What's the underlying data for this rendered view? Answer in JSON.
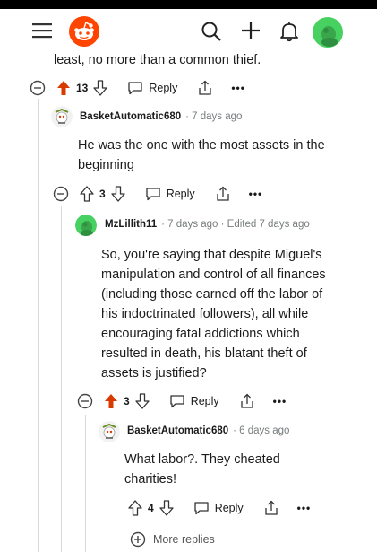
{
  "header": {
    "menu_icon": "hamburger-icon",
    "logo_icon": "reddit-logo-icon",
    "search_icon": "search-icon",
    "create_icon": "plus-icon",
    "notifications_icon": "bell-icon",
    "avatar_icon": "user-avatar-icon"
  },
  "top_comment": {
    "text_tail": "least, no more than a common thief.",
    "votes": "13",
    "reply_label": "Reply",
    "vote_state": "upvoted"
  },
  "comments": [
    {
      "user": "BasketAutomatic680",
      "time": "· 7 days ago",
      "text": [
        "He was the one with the most assets in the",
        "beginning"
      ],
      "votes": "3",
      "reply_label": "Reply",
      "vote_state": "none"
    },
    {
      "user": "MzLillith11",
      "time": "· 7 days ago · Edited 7 days ago",
      "text": [
        "So, you're saying that despite Miguel's",
        "manipulation and control of all finances",
        "(including those earned off the labor of",
        "his indoctrinated followers), all while",
        "encouraging fatal addictions which",
        "resulted in death, his blatant theft of",
        "assets is justified?"
      ],
      "votes": "3",
      "reply_label": "Reply",
      "vote_state": "upvoted"
    },
    {
      "user": "BasketAutomatic680",
      "time": "· 6 days ago",
      "text": [
        "What labor?. They cheated",
        "charities!"
      ],
      "votes": "4",
      "reply_label": "Reply",
      "vote_state": "none"
    }
  ],
  "more_replies": "More replies",
  "colors": {
    "upvote": "#d93a00",
    "snoo": "#ff4500",
    "avatar_green": "#46d160"
  }
}
